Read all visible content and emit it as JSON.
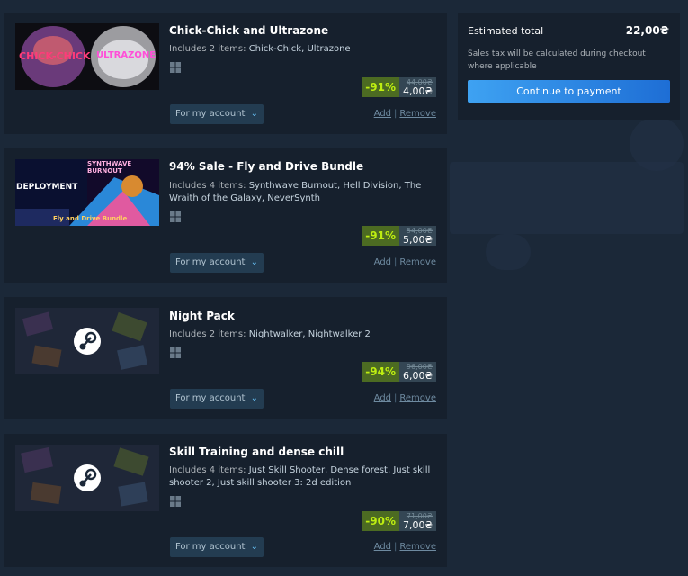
{
  "summary": {
    "label": "Estimated total",
    "total": "22,00₴",
    "note": "Sales tax will be calculated during checkout where applicable",
    "button_label": "Continue to payment"
  },
  "items": [
    {
      "title": "Chick-Chick and Ultrazone",
      "includes_label": "Includes 2 items:",
      "includes_list": "Chick-Chick, Ultrazone",
      "capsule_text_1": "CHICK-CHICK",
      "capsule_text_2": "ULTRAZONE",
      "discount": "-91%",
      "original_price": "44,00₴",
      "final_price": "4,00₴",
      "account_option": "For my account",
      "add_label": "Add",
      "remove_label": "Remove"
    },
    {
      "title": "94% Sale - Fly and Drive Bundle",
      "includes_label": "Includes 4 items:",
      "includes_list": "Synthwave Burnout, Hell Division, The Wraith of the Galaxy, NeverSynth",
      "capsule_text_1": "SYNTHWAVE BURNOUT",
      "capsule_text_2": "DEPLOYMENT",
      "capsule_text_3": "Fly and Drive Bundle",
      "discount": "-91%",
      "original_price": "54,00₴",
      "final_price": "5,00₴",
      "account_option": "For my account",
      "add_label": "Add",
      "remove_label": "Remove"
    },
    {
      "title": "Night Pack",
      "includes_label": "Includes 2 items:",
      "includes_list": "Nightwalker, Nightwalker 2",
      "discount": "-94%",
      "original_price": "96,00₴",
      "final_price": "6,00₴",
      "account_option": "For my account",
      "add_label": "Add",
      "remove_label": "Remove"
    },
    {
      "title": "Skill Training and dense chill",
      "includes_label": "Includes 4 items:",
      "includes_list": "Just Skill Shooter, Dense forest, Just skill shooter 2, Just skill shooter 3: 2d edition",
      "discount": "-90%",
      "original_price": "71,00₴",
      "final_price": "7,00₴",
      "account_option": "For my account",
      "add_label": "Add",
      "remove_label": "Remove"
    }
  ],
  "colors": {
    "background": "#1b2838",
    "panel": "#16202d",
    "discount_bg": "#4c6b22",
    "discount_text": "#beee11",
    "accent_button": "#1e6ed5"
  },
  "icons": [
    "windows-icon",
    "steam-logo-icon",
    "chevron-down-icon"
  ]
}
